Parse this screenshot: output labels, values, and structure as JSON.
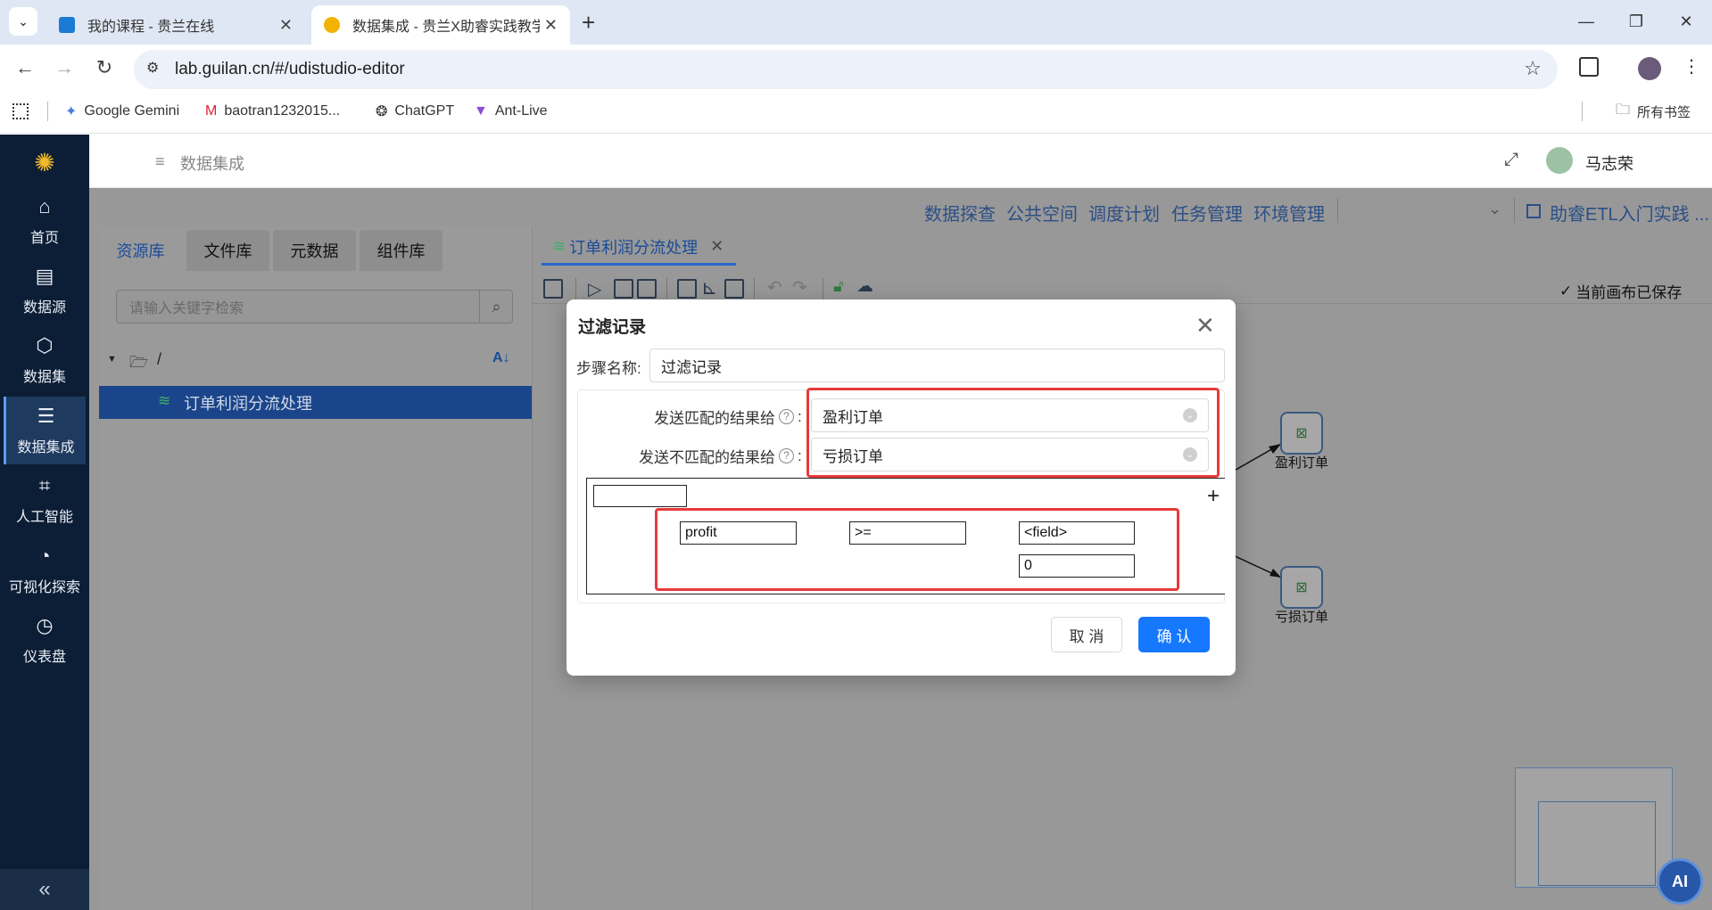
{
  "browser": {
    "tabs": [
      {
        "title": "我的课程 - 贵兰在线"
      },
      {
        "title": "数据集成 - 贵兰X助睿实践教学"
      }
    ],
    "url": "lab.guilan.cn/#/udistudio-editor",
    "bookmarks": [
      "Google Gemini",
      "baotran1232015...",
      "ChatGPT",
      "Ant-Live"
    ],
    "bookmarks_folder": "所有书签"
  },
  "sidebar": {
    "items": [
      {
        "label": "首页",
        "icon": "home-icon"
      },
      {
        "label": "数据源",
        "icon": "database-icon"
      },
      {
        "label": "数据集",
        "icon": "cube-icon"
      },
      {
        "label": "数据集成",
        "icon": "integration-icon"
      },
      {
        "label": "人工智能",
        "icon": "ai-icon"
      },
      {
        "label": "可视化探索",
        "icon": "pie-chart-icon"
      },
      {
        "label": "仪表盘",
        "icon": "dashboard-icon"
      }
    ],
    "collapse": "«"
  },
  "header": {
    "breadcrumb": "数据集成",
    "user": "马志荣"
  },
  "toplinks": [
    "数据探查",
    "公共空间",
    "调度计划",
    "任务管理",
    "环境管理"
  ],
  "project": "助睿ETL入门实践 ...",
  "leftpanel": {
    "tabs": [
      "资源库",
      "文件库",
      "元数据",
      "组件库"
    ],
    "search_placeholder": "请输入关键字检索",
    "root": "/",
    "selected_item": "订单利润分流处理"
  },
  "editor": {
    "tab": "订单利润分流处理",
    "saved_status": "当前画布已保存",
    "nodes": [
      {
        "label": "盈利订单"
      },
      {
        "label": "亏损订单"
      }
    ]
  },
  "ai_button": "AI",
  "modal": {
    "title": "过滤记录",
    "step_label": "步骤名称:",
    "step_value": "过滤记录",
    "match_label": "发送匹配的结果给",
    "match_value": "盈利订单",
    "nomatch_label": "发送不匹配的结果给",
    "nomatch_value": "亏损订单",
    "colon": ":",
    "add": "+",
    "condition": {
      "field": "profit",
      "operator": ">=",
      "value_type": "<field>",
      "value": "0"
    },
    "cancel": "取 消",
    "confirm": "确 认"
  }
}
